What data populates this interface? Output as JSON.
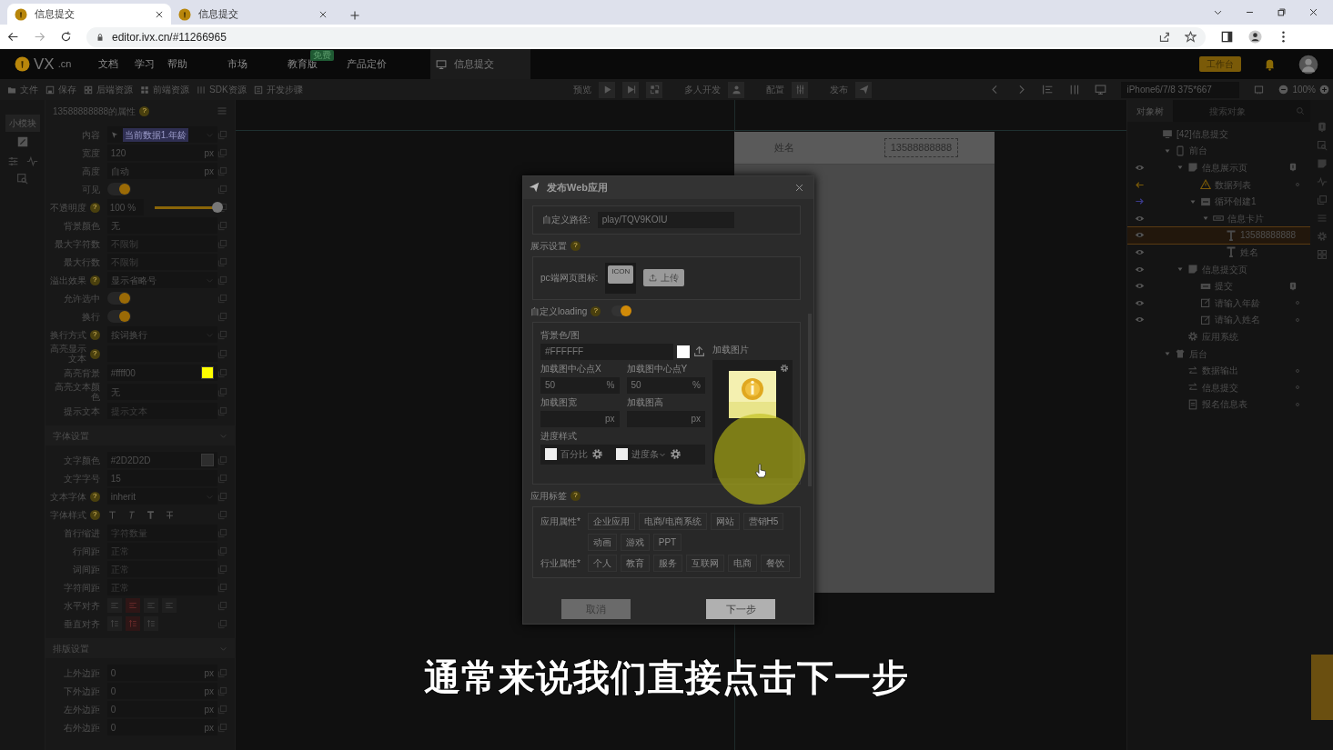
{
  "browser": {
    "tabs": [
      {
        "title": "信息提交",
        "selected": true
      },
      {
        "title": "信息提交",
        "selected": false
      }
    ],
    "address": "editor.ivx.cn/#11266965"
  },
  "header": {
    "logo": "VX",
    "logo_suffix": ".cn",
    "menu": [
      {
        "label": "文档"
      },
      {
        "label": "学习"
      },
      {
        "label": "帮助"
      },
      {
        "label": "市场"
      },
      {
        "label": "教育版",
        "badge": "免费"
      },
      {
        "label": "产品定价"
      }
    ],
    "doc_tab": "信息提交",
    "workspace_button": "工作台"
  },
  "toolbar": {
    "left": [
      "文件",
      "保存",
      "后端资源",
      "前端资源",
      "SDK资源",
      "开发步骤"
    ],
    "preview": "预览",
    "multi": "多人开发",
    "config": "配置",
    "publish": "发布",
    "device": "iPhone6/7/8 375*667",
    "zoom": "100%"
  },
  "sidebar": {
    "module_button": "小模块"
  },
  "properties": {
    "title": "13588888888的属性",
    "help": "?",
    "rows": [
      {
        "label": "内容",
        "kind": "binding",
        "value": "当前数据1.年龄"
      },
      {
        "label": "宽度",
        "kind": "input",
        "value": "120",
        "unit": "px"
      },
      {
        "label": "高度",
        "kind": "input",
        "value": "自动",
        "unit": "px"
      },
      {
        "label": "可见",
        "kind": "switch",
        "on": true
      },
      {
        "label": "不透明度",
        "help": "?",
        "kind": "slider",
        "value": "100 %",
        "level": 1
      },
      {
        "label": "背景颜色",
        "kind": "input",
        "value": "无"
      },
      {
        "label": "最大字符数",
        "kind": "input",
        "placeholder": "不限制"
      },
      {
        "label": "最大行数",
        "kind": "input",
        "placeholder": "不限制"
      },
      {
        "label": "溢出效果",
        "help": "?",
        "kind": "select",
        "value": "显示省略号"
      },
      {
        "label": "允许选中",
        "kind": "switch",
        "on": true
      },
      {
        "label": "换行",
        "kind": "switch",
        "on": true
      },
      {
        "label": "换行方式",
        "help": "?",
        "kind": "select",
        "value": "按词换行"
      },
      {
        "label": "高亮显示文本",
        "help": "?",
        "kind": "input"
      },
      {
        "label": "高亮背景",
        "kind": "color",
        "value": "#ffff00"
      },
      {
        "label": "高亮文本颜色",
        "kind": "input",
        "value": "无"
      },
      {
        "label": "提示文本",
        "kind": "input",
        "placeholder": "提示文本"
      }
    ],
    "sections": [
      {
        "title": "字体设置",
        "rows": [
          {
            "label": "文字颜色",
            "kind": "color",
            "value": "#2D2D2D"
          },
          {
            "label": "文字字号",
            "kind": "input",
            "value": "15"
          },
          {
            "label": "文本字体",
            "help": "?",
            "kind": "select",
            "value": "inherit"
          },
          {
            "label": "字体样式",
            "help": "?",
            "kind": "text-style"
          },
          {
            "label": "首行缩进",
            "kind": "input",
            "placeholder": "字符数量"
          },
          {
            "label": "行间距",
            "kind": "input",
            "placeholder": "正常"
          },
          {
            "label": "词间距",
            "kind": "input",
            "placeholder": "正常"
          },
          {
            "label": "字符间距",
            "kind": "input",
            "placeholder": "正常"
          },
          {
            "label": "水平对齐",
            "kind": "align",
            "options": [
              {
                "selected": false
              },
              {
                "selected": true
              },
              {
                "selected": false
              },
              {
                "selected": false
              }
            ]
          },
          {
            "label": "垂直对齐",
            "kind": "align",
            "options": [
              {
                "selected": false
              },
              {
                "selected": true
              },
              {
                "selected": false
              }
            ]
          }
        ]
      },
      {
        "title": "排版设置",
        "rows": [
          {
            "label": "上外边距",
            "kind": "input",
            "value": "0",
            "unit": "px"
          },
          {
            "label": "下外边距",
            "kind": "input",
            "value": "0",
            "unit": "px"
          },
          {
            "label": "左外边距",
            "kind": "input",
            "value": "0",
            "unit": "px"
          },
          {
            "label": "右外边距",
            "kind": "input",
            "value": "0",
            "unit": "px"
          }
        ]
      }
    ]
  },
  "preview": {
    "rows": [
      {
        "label": "姓名",
        "value": "13588888888",
        "selected": true
      }
    ]
  },
  "dialog": {
    "title": "发布Web应用",
    "path_label": "自定义路径:",
    "path_value": "play/TQV9KOIU",
    "display_section": "展示设置",
    "help": "?",
    "pc_icon_label": "pc端网页图标:",
    "icon_text": "ICON",
    "upload_button": "上传",
    "loading_label": "自定义loading",
    "loading_on": true,
    "bg_label": "背景色/图",
    "bg_value": "#FFFFFF",
    "image_label": "加载图片",
    "fields": [
      {
        "label": "加载图中心点X",
        "value": "50",
        "unit": "%"
      },
      {
        "label": "加载图中心点Y",
        "value": "50",
        "unit": "%"
      },
      {
        "label": "加载图宽",
        "unit": "px"
      },
      {
        "label": "加载图高",
        "unit": "px"
      }
    ],
    "progress_label": "进度样式",
    "progress_options": [
      {
        "label": "百分比",
        "checked": false,
        "menu": false
      },
      {
        "label": "进度条",
        "checked": false,
        "menu": true
      }
    ],
    "tags_section": "应用标签",
    "tag_groups": [
      {
        "label": "应用属性*",
        "tags": [
          "企业应用",
          "电商/电商系统",
          "网站",
          "营销H5",
          "动画",
          "游戏",
          "PPT"
        ]
      },
      {
        "label": "行业属性*",
        "tags": [
          "个人",
          "教育",
          "服务",
          "互联网",
          "电商",
          "餐饮"
        ]
      }
    ],
    "cancel": "取消",
    "next": "下一步"
  },
  "tree": {
    "tab": "对象树",
    "search": {
      "placeholder": "搜索对象"
    },
    "items": [
      {
        "label": "[42]信息提交",
        "kind": "app",
        "eye": false,
        "selected": false,
        "children": [
          {
            "label": "前台",
            "kind": "device",
            "eye": false,
            "selected": false,
            "children": [
              {
                "label": "信息展示页",
                "kind": "page",
                "eye": true,
                "selected": false,
                "info": true,
                "children": [
                  {
                    "label": "数据列表",
                    "kind": "warning",
                    "eye": false,
                    "link_in": true,
                    "selected": false,
                    "dot": true
                  },
                  {
                    "label": "循环创建1",
                    "kind": "loop",
                    "eye": false,
                    "link_out": true,
                    "selected": false,
                    "children": [
                      {
                        "label": "信息卡片",
                        "kind": "card",
                        "eye": true,
                        "selected": false,
                        "children": [
                          {
                            "label": "13588888888",
                            "kind": "text",
                            "eye": true,
                            "selected": true
                          },
                          {
                            "label": "姓名",
                            "kind": "text",
                            "eye": true,
                            "selected": false
                          }
                        ]
                      }
                    ]
                  }
                ]
              },
              {
                "label": "信息提交页",
                "kind": "page",
                "eye": true,
                "selected": false,
                "children": [
                  {
                    "label": "提交",
                    "kind": "button",
                    "eye": true,
                    "selected": false,
                    "info": true
                  },
                  {
                    "label": "请输入年龄",
                    "kind": "input",
                    "eye": true,
                    "selected": false,
                    "dot": true
                  },
                  {
                    "label": "请输入姓名",
                    "kind": "input",
                    "eye": true,
                    "selected": false,
                    "dot": true
                  }
                ]
              },
              {
                "label": "应用系统",
                "kind": "system",
                "eye": false,
                "selected": false
              }
            ]
          },
          {
            "label": "后台",
            "kind": "server",
            "eye": false,
            "selected": false,
            "children": [
              {
                "label": "数据输出",
                "kind": "data",
                "eye": false,
                "selected": false,
                "dot": true
              },
              {
                "label": "信息提交",
                "kind": "data",
                "eye": false,
                "selected": false,
                "dot": true
              },
              {
                "label": "报名信息表",
                "kind": "table",
                "eye": false,
                "selected": false,
                "dot": true
              }
            ]
          }
        ]
      }
    ]
  },
  "subtitle": "通常来说我们直接点击下一步"
}
